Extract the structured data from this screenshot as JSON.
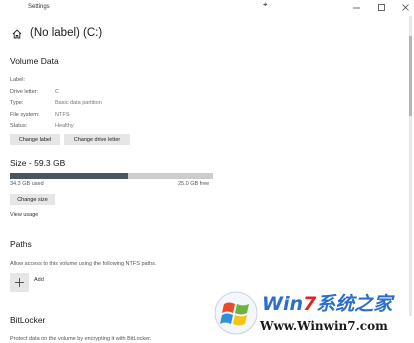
{
  "window": {
    "title": "Settings",
    "controls": {
      "minimize": "—",
      "maximize": "□",
      "close": "✕"
    }
  },
  "header": {
    "title": "(No label) (C:)",
    "icon": "home-icon"
  },
  "volume_data": {
    "heading": "Volume Data",
    "properties": [
      {
        "label": "Label:",
        "value": ""
      },
      {
        "label": "Drive letter:",
        "value": "C"
      },
      {
        "label": "Type:",
        "value": "Basic data partition"
      },
      {
        "label": "File system:",
        "value": "NTFS"
      },
      {
        "label": "Status:",
        "value": "Healthy"
      }
    ],
    "change_label_button": "Change label",
    "change_drive_letter_button": "Change drive letter"
  },
  "size": {
    "heading": "Size - 59.3 GB",
    "used_text": "34.3 GB used",
    "free_text": "25.0 GB free",
    "used_fraction": 0.58,
    "change_size_button": "Change size",
    "view_usage_link": "View usage"
  },
  "paths": {
    "heading": "Paths",
    "description": "Allow access to this volume using the following NTFS paths.",
    "add_label": "Add"
  },
  "bitlocker": {
    "heading": "BitLocker",
    "description": "Protect data on the volume by encrypting it with BitLocker."
  },
  "watermark": {
    "title_part1": "Win",
    "title_part2": "7",
    "title_part3": "系统之家",
    "url": "Www.Winwin7.com"
  },
  "colors": {
    "bar_used": "#4a5560",
    "bar_free": "#cccccc",
    "button_bg": "#e6e6e6",
    "watermark_blue": "#2a6fc9",
    "watermark_red": "#e0261c"
  }
}
